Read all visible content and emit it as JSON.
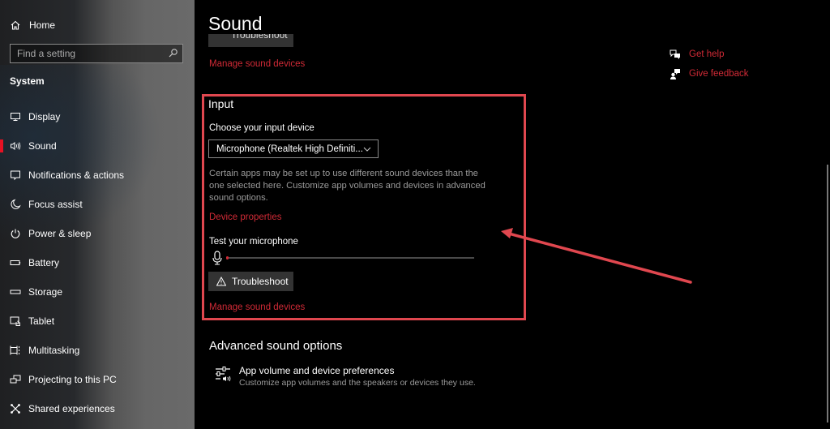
{
  "sidebar": {
    "home_label": "Home",
    "search_placeholder": "Find a setting",
    "section_label": "System",
    "items": [
      {
        "label": "Display",
        "icon": "display-icon"
      },
      {
        "label": "Sound",
        "icon": "speaker-icon",
        "active": true
      },
      {
        "label": "Notifications & actions",
        "icon": "notification-icon"
      },
      {
        "label": "Focus assist",
        "icon": "moon-icon"
      },
      {
        "label": "Power & sleep",
        "icon": "power-icon"
      },
      {
        "label": "Battery",
        "icon": "battery-icon"
      },
      {
        "label": "Storage",
        "icon": "storage-icon"
      },
      {
        "label": "Tablet",
        "icon": "tablet-icon"
      },
      {
        "label": "Multitasking",
        "icon": "multitasking-icon"
      },
      {
        "label": "Projecting to this PC",
        "icon": "projecting-icon"
      },
      {
        "label": "Shared experiences",
        "icon": "shared-icon"
      }
    ]
  },
  "main": {
    "title": "Sound",
    "output_section": {
      "troubleshoot_label": "Troubleshoot",
      "manage_link": "Manage sound devices"
    },
    "input_section": {
      "heading": "Input",
      "choose_label": "Choose your input device",
      "device_selected": "Microphone (Realtek High Definiti...",
      "description": "Certain apps may be set up to use different sound devices than the one selected here. Customize app volumes and devices in advanced sound options.",
      "device_properties_link": "Device properties",
      "test_label": "Test your microphone",
      "mic_level_percent": 1,
      "troubleshoot_label": "Troubleshoot",
      "manage_link": "Manage sound devices"
    },
    "advanced": {
      "heading": "Advanced sound options",
      "item_title": "App volume and device preferences",
      "item_subtitle": "Customize app volumes and the speakers or devices they use."
    },
    "help": {
      "get_help": "Get help",
      "give_feedback": "Give feedback"
    }
  },
  "colors": {
    "accent": "#d12a36",
    "annotation": "#e0474f",
    "active_indicator": "#e81123"
  }
}
